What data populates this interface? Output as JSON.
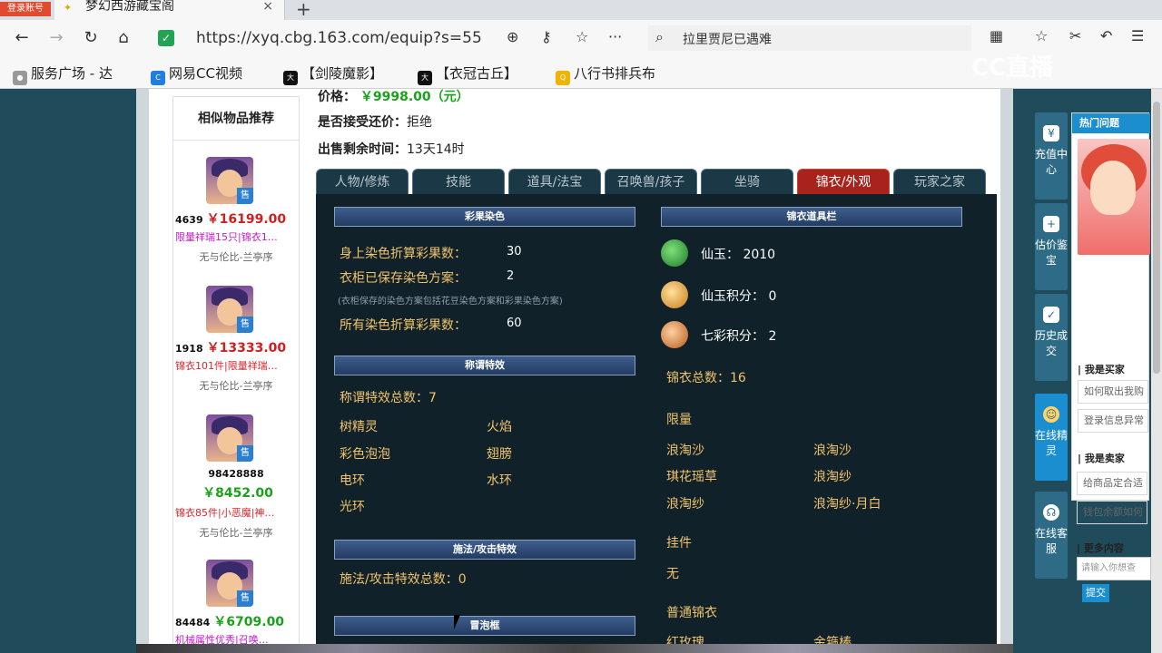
{
  "browser": {
    "login_badge": "登录账号",
    "tab_title": "梦幻西游藏宝阁",
    "tab_close": "×",
    "new_tab": "+",
    "url": "https://xyq.cbg.163.com/equip?s=55",
    "search_text": "拉里贾尼已遇难",
    "bookmarks": [
      "服务广场 - 达",
      "网易CC视频",
      "【剑陵魔影】",
      "【衣冠古丘】",
      "八行书排兵布"
    ],
    "watermark": "CC直播"
  },
  "similar": {
    "title": "相似物品推荐",
    "sell_badge": "售",
    "items": [
      {
        "id": "4639",
        "price": "￥16199.00",
        "tags": "限量祥瑞15只|锦衣1…",
        "server": "无与伦比-兰亭序"
      },
      {
        "id": "1918",
        "price": "￥13333.00",
        "tags": "锦衣101件|限量祥瑞…",
        "server": "无与伦比-兰亭序"
      },
      {
        "id": "98428888",
        "price": "￥8452.00",
        "tags": "锦衣85件|小恶魔|神…",
        "server": "无与伦比-兰亭序"
      },
      {
        "id": "84484",
        "price": "￥6709.00",
        "tags": "机械属性优秀|召唤…",
        "server": ""
      }
    ]
  },
  "info": {
    "price_label": "价格：",
    "price_value": "￥9998.00（元）",
    "bargain_label": "是否接受还价：",
    "bargain_value": "拒绝",
    "time_label": "出售剩余时间：",
    "time_value": "13天14时"
  },
  "tabs": [
    "人物/修炼",
    "技能",
    "道具/法宝",
    "召唤兽/孩子",
    "坐骑",
    "锦衣/外观",
    "玩家之家"
  ],
  "left": {
    "dye_title": "彩果染色",
    "dye_rows": [
      {
        "label": "身上染色折算彩果数：",
        "value": "30"
      },
      {
        "label": "衣柜已保存染色方案：",
        "value": "2"
      },
      {
        "label": "所有染色折算彩果数：",
        "value": "60"
      }
    ],
    "dye_note": "(衣柜保存的染色方案包括花豆染色方案和彩果染色方案)",
    "title_fx_title": "称谓特效",
    "title_fx_total": "称谓特效总数：7",
    "title_fx_items": [
      "树精灵",
      "火焰",
      "彩色泡泡",
      "翅膀",
      "电环",
      "水环",
      "光环"
    ],
    "cast_fx_title": "施法/攻击特效",
    "cast_fx_total": "施法/攻击特效总数：0",
    "bubble_title": "冒泡框"
  },
  "right": {
    "bar_title": "锦衣道具栏",
    "coins": [
      {
        "icon": "jade-coin-icon",
        "label": "仙玉：",
        "value": "2010"
      },
      {
        "icon": "jade-points-icon",
        "label": "仙玉积分：",
        "value": "0"
      },
      {
        "icon": "rainbow-points-icon",
        "label": "七彩积分：",
        "value": "2"
      }
    ],
    "total": "锦衣总数：16",
    "limited_title": "限量",
    "limited_items": [
      "浪淘沙",
      "浪淘沙",
      "琪花瑶草",
      "浪淘纱",
      "浪淘纱",
      "浪淘纱·月白"
    ],
    "pendant_title": "挂件",
    "pendant_value": "无",
    "normal_title": "普通锦衣",
    "normal_items": [
      "红玫瑰",
      "金箍棒"
    ]
  },
  "sidebar": {
    "buttons": [
      "充值中心",
      "估价鉴宝",
      "历史成交",
      "在线精灵",
      "在线客服"
    ],
    "hot_tab": "热门问题",
    "buyer_head": "我是买家",
    "buyer_q": [
      "如何取出我购",
      "登录信息异常"
    ],
    "seller_head": "我是卖家",
    "seller_q": [
      "给商品定合适",
      "钱包余额如何"
    ],
    "more_head": "更多内容",
    "input_placeholder": "请输入你想查",
    "submit": "提交"
  },
  "colors": {
    "accent_blue": "#1b8ed0",
    "active_tab": "#a8231c",
    "price_red": "#d01f1f",
    "price_green": "#18a21b",
    "label_yellow": "#f1c36a",
    "label_orange": "#e49a3a"
  }
}
